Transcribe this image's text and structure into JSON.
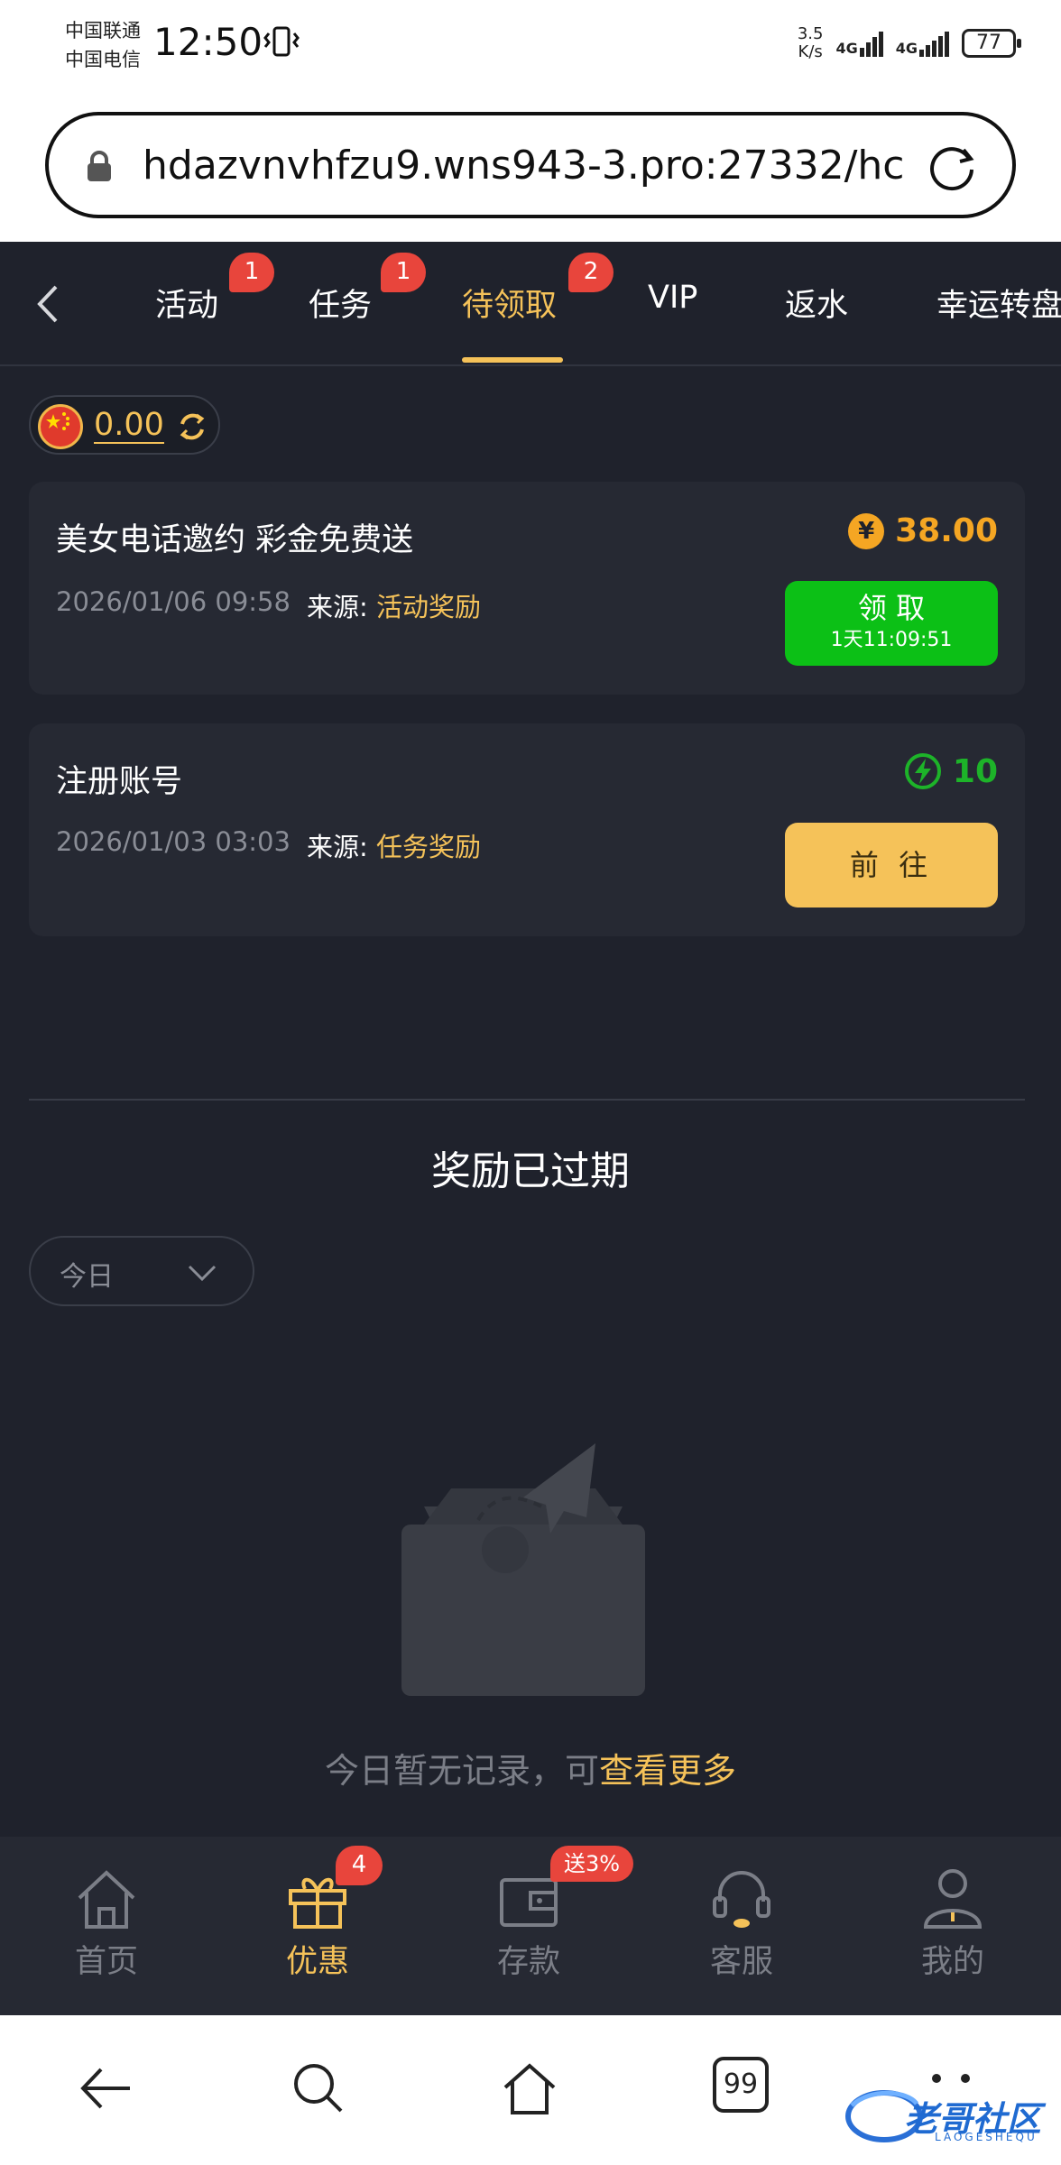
{
  "status_bar": {
    "carrier1": "中国联通",
    "carrier2": "中国电信",
    "time": "12:50",
    "net_speed_value": "3.5",
    "net_speed_unit": "K/s",
    "network1": "4G",
    "network2": "4G",
    "battery": "77"
  },
  "browser": {
    "url": "hdazvnvhfzu9.wns943-3.pro:27332/hc"
  },
  "tabs": [
    {
      "label": "活动",
      "badge": "1"
    },
    {
      "label": "任务",
      "badge": "1"
    },
    {
      "label": "待领取",
      "badge": "2",
      "active": true
    },
    {
      "label": "VIP"
    },
    {
      "label": "返水"
    },
    {
      "label": "幸运转盘"
    }
  ],
  "balance": {
    "value": "0.00"
  },
  "rewards": [
    {
      "title": "美女电话邀约 彩金免费送",
      "date": "2026/01/06 09:58",
      "source_label": "来源:",
      "source_value": "活动奖励",
      "amount": "38.00",
      "amount_icon": "yen-coin-icon",
      "amount_color": "#f5a623",
      "button_label": "领 取",
      "button_sub": "1天11:09:51",
      "button_color": "#0cc016"
    },
    {
      "title": "注册账号",
      "date": "2026/01/03 03:03",
      "source_label": "来源:",
      "source_value": "任务奖励",
      "amount": "10",
      "amount_icon": "lightning-icon",
      "amount_color": "#1db329",
      "button_label": "前 往",
      "button_color": "#f5c259"
    }
  ],
  "expired": {
    "title": "奖励已过期",
    "filter_value": "今日",
    "empty_text": "今日暂无记录，可",
    "empty_link": "查看更多"
  },
  "bottom_nav": [
    {
      "label": "首页",
      "icon": "home-icon"
    },
    {
      "label": "优惠",
      "icon": "gift-icon",
      "badge": "4",
      "active": true
    },
    {
      "label": "存款",
      "icon": "wallet-icon",
      "badge": "送3%"
    },
    {
      "label": "客服",
      "icon": "headset-icon"
    },
    {
      "label": "我的",
      "icon": "user-icon"
    }
  ],
  "system_nav": {
    "tabs_count": "99",
    "watermark": "老哥社区",
    "watermark_sub": "LAOGESHEQU"
  },
  "colors": {
    "accent": "#f5c259",
    "background": "#1f222c",
    "card": "#262933",
    "badge": "#e8453c"
  }
}
